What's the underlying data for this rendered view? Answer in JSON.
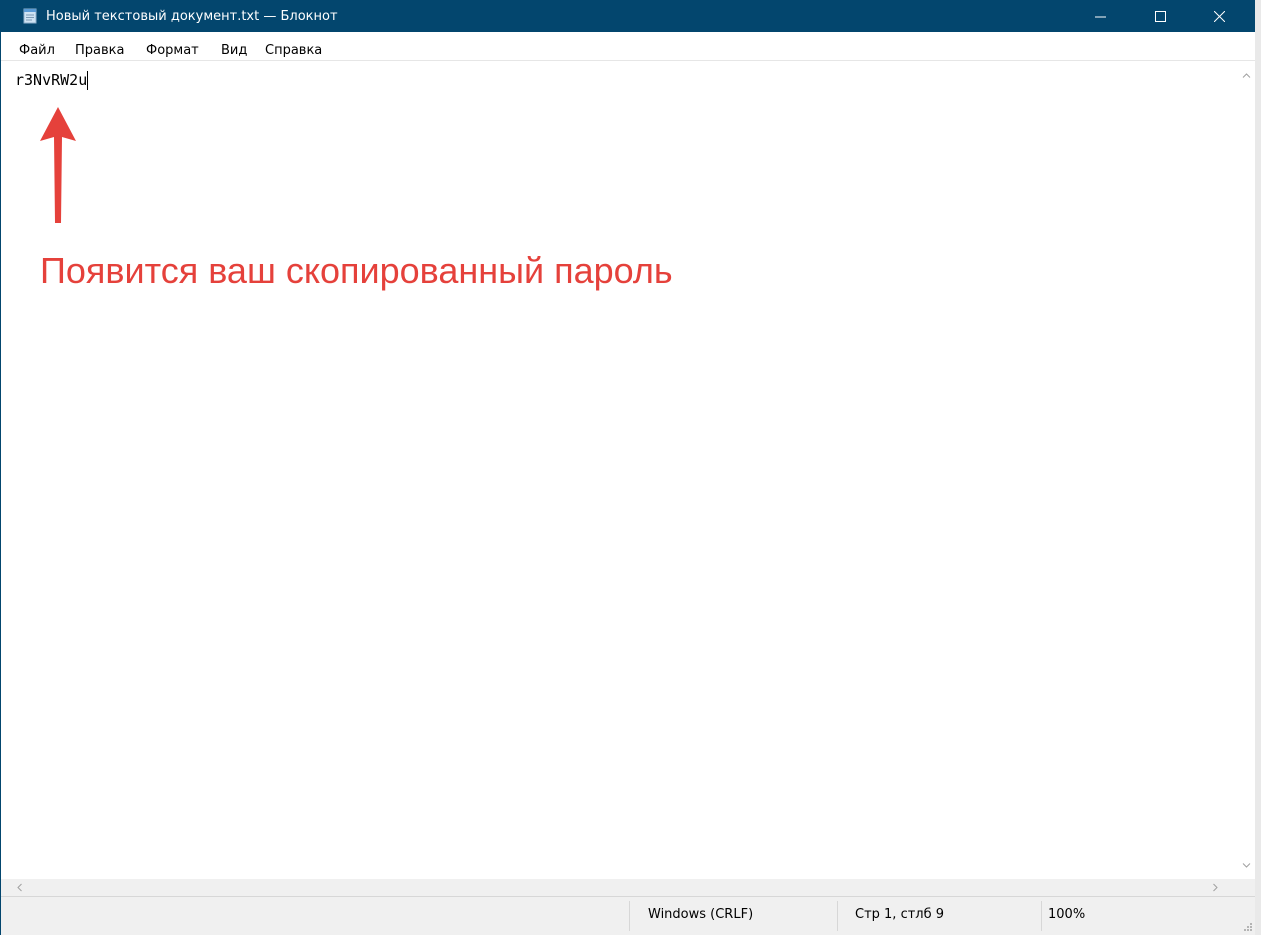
{
  "window": {
    "title": "Новый текстовый документ.txt — Блокнот",
    "icon": "notepad-icon",
    "controls": {
      "minimize_icon": "minimize-icon",
      "maximize_icon": "maximize-icon",
      "close_icon": "close-icon"
    },
    "title_color": "#03466e"
  },
  "menu": {
    "items": [
      {
        "label": "Файл"
      },
      {
        "label": "Правка"
      },
      {
        "label": "Формат"
      },
      {
        "label": "Вид"
      },
      {
        "label": "Справка"
      }
    ]
  },
  "editor": {
    "content": "r3NvRW2u"
  },
  "annotation": {
    "text": "Появится ваш скопированный пароль",
    "color": "#e5413b",
    "icon": "arrow-up-icon"
  },
  "statusbar": {
    "line_ending": "Windows (CRLF)",
    "position": "Стр 1, стлб 9",
    "zoom": "100%"
  }
}
